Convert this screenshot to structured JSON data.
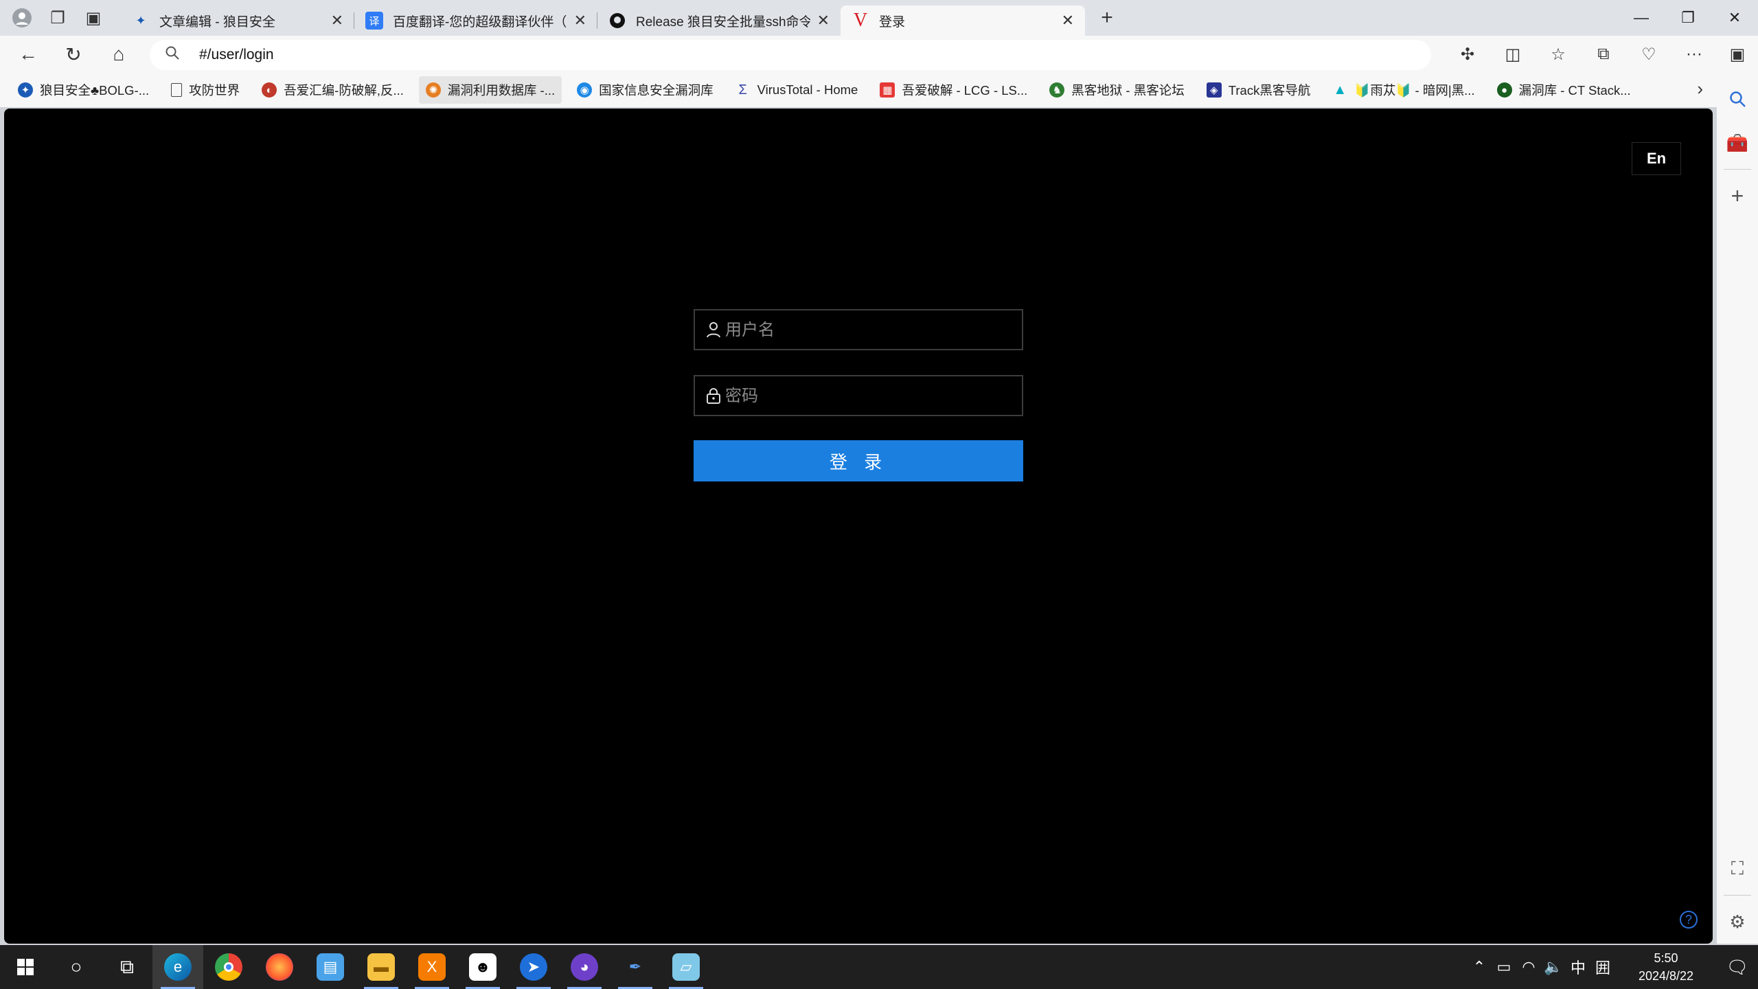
{
  "browser": {
    "tabs": [
      {
        "title": "文章编辑 - 狼目安全",
        "fav_glyph": "✦",
        "fav_color": "#1a5bb5"
      },
      {
        "title": "百度翻译-您的超级翻译伙伴（文",
        "fav_glyph": "译",
        "fav_color": "#2f7cf6"
      },
      {
        "title": "Release 狼目安全批量ssh命令执",
        "fav_glyph": "●",
        "fav_color": "#111111"
      },
      {
        "title": "登录",
        "fav_glyph": "V",
        "fav_color": "#d71921"
      }
    ],
    "active_tab_index": 3,
    "address": "#/user/login",
    "bookmarks": [
      {
        "label": "狼目安全♣BOLG-...",
        "color": "#1a5bb5"
      },
      {
        "label": "攻防世界",
        "color": "#666666"
      },
      {
        "label": "吾爱汇编-防破解,反...",
        "color": "#c0392b"
      },
      {
        "label": "漏洞利用数据库 -...",
        "color": "#e67e22"
      },
      {
        "label": "国家信息安全漏洞库",
        "color": "#1e88e5"
      },
      {
        "label": "VirusTotal - Home",
        "color": "#3949ab"
      },
      {
        "label": "吾爱破解 - LCG - LS...",
        "color": "#e53935"
      },
      {
        "label": "黑客地狱 - 黑客论坛",
        "color": "#2e7d32"
      },
      {
        "label": "Track黑客导航",
        "color": "#283593"
      },
      {
        "label": "🔰雨苁🔰 - 暗网|黑...",
        "color": "#00acc1"
      },
      {
        "label": "漏洞库 - CT Stack...",
        "color": "#1b5e20"
      }
    ]
  },
  "page": {
    "lang_button": "En",
    "username_placeholder": "用户名",
    "password_placeholder": "密码",
    "login_label": "登 录",
    "help_glyph": "?"
  },
  "taskbar": {
    "time": "5:50",
    "date": "2024/8/22",
    "ime": "中",
    "ime2": "囲"
  }
}
